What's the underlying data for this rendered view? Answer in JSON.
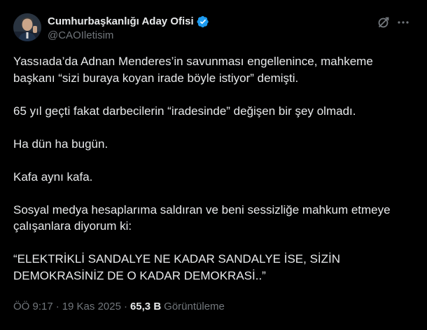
{
  "author": {
    "display_name": "Cumhurbaşkanlığı Aday Ofisi",
    "handle": "@CAOIletisim",
    "verified": true
  },
  "post": {
    "paragraphs": [
      "Yassıada’da Adnan Menderes’in savunması engellenince, mahkeme başkanı “sizi buraya koyan irade böyle istiyor” demişti.",
      "65 yıl geçti fakat darbecilerin “iradesinde” değişen bir şey olmadı.",
      "Ha dün ha bugün.",
      "Kafa aynı kafa.",
      "Sosyal medya hesaplarıma saldıran ve beni sessizliğe mahkum etmeye çalışanlara diyorum ki:",
      "“ELEKTRİKLİ SANDALYE NE KADAR SANDALYE İSE, SİZİN DEMOKRASİNİZ DE O KADAR DEMOKRASİ..”"
    ]
  },
  "meta": {
    "time": "ÖÖ 9:17",
    "separator": "·",
    "date": "19 Kas 2025",
    "views_count": "65,3 B",
    "views_label": "Görüntüleme"
  },
  "icons": {
    "verified": "verified-badge-icon",
    "grok": "grok-icon",
    "more": "more-options-icon"
  },
  "colors": {
    "background": "#000000",
    "text": "#e7e9ea",
    "secondary": "#71767b",
    "verified": "#1d9bf0"
  }
}
